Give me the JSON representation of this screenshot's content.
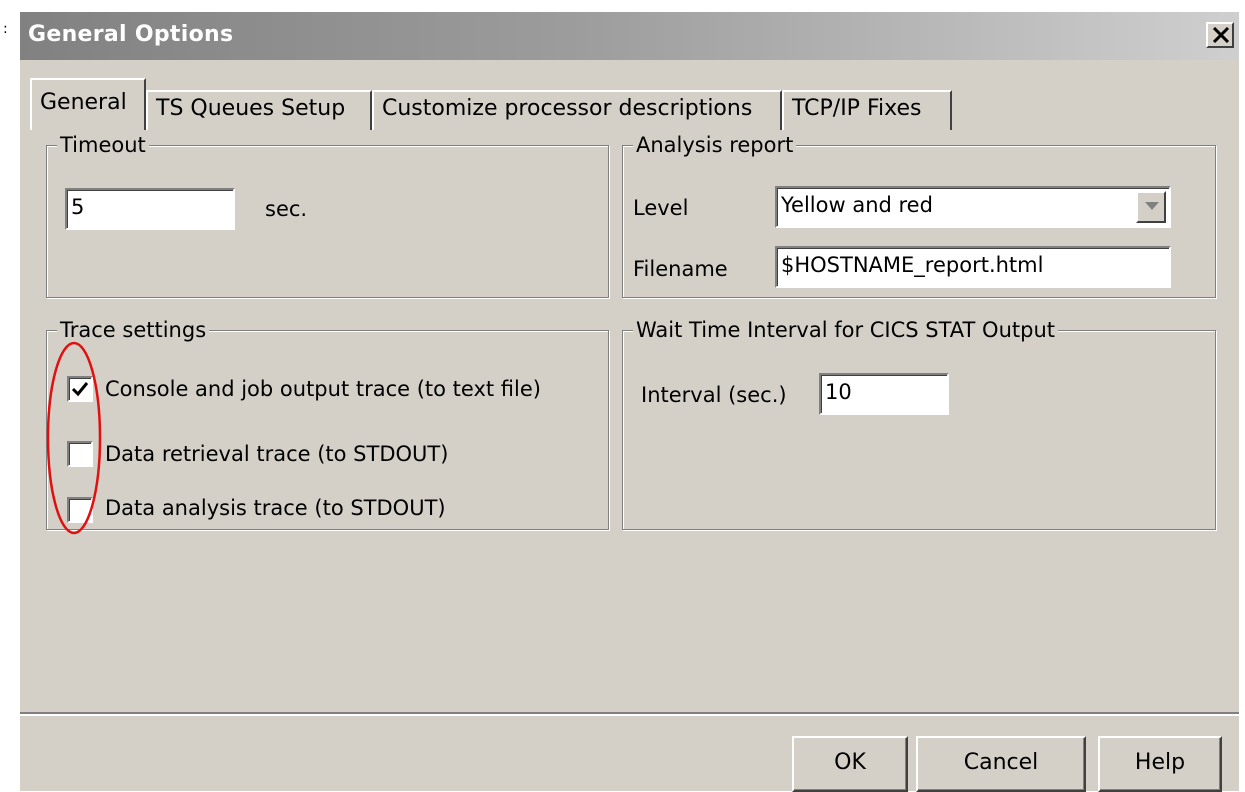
{
  "window": {
    "title": "General Options",
    "close_glyph": "✕"
  },
  "tabs": [
    {
      "label": "General",
      "active": true
    },
    {
      "label": "TS Queues Setup",
      "active": false
    },
    {
      "label": "Customize processor descriptions",
      "active": false
    },
    {
      "label": "TCP/IP Fixes",
      "active": false
    }
  ],
  "timeout": {
    "group_label": "Timeout",
    "value": "5",
    "unit": "sec."
  },
  "analysis_report": {
    "group_label": "Analysis report",
    "level_label": "Level",
    "level_value": "Yellow and red",
    "filename_label": "Filename",
    "filename_value": "$HOSTNAME_report.html"
  },
  "trace_settings": {
    "group_label": "Trace settings",
    "items": [
      {
        "label": "Console and job output trace (to text file)",
        "checked": true
      },
      {
        "label": "Data retrieval trace (to STDOUT)",
        "checked": false
      },
      {
        "label": "Data analysis trace (to STDOUT)",
        "checked": false
      }
    ]
  },
  "wait_time": {
    "group_label": "Wait Time Interval for CICS STAT Output",
    "interval_label": "Interval (sec.)",
    "interval_value": "10"
  },
  "buttons": {
    "ok": "OK",
    "cancel": "Cancel",
    "help": "Help"
  },
  "annotation": {
    "color": "#e01010"
  },
  "colors": {
    "face": "#d4d0c8",
    "title_dark": "#818181",
    "title_light": "#cfcfcf"
  }
}
